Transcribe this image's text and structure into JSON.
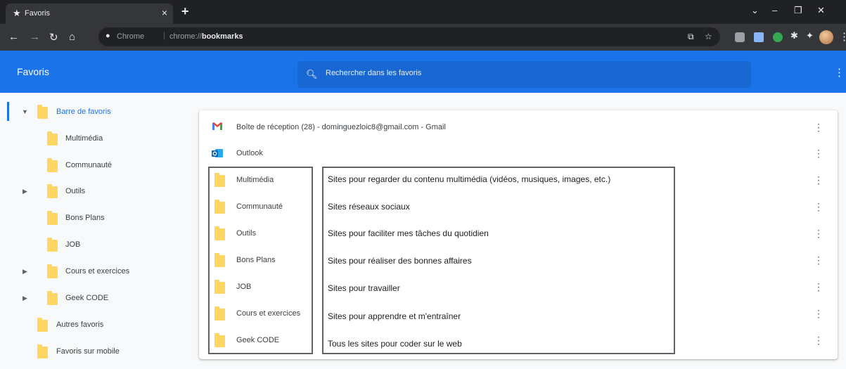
{
  "browser": {
    "tab_title": "Favoris",
    "address_label": "Chrome",
    "address_url_prefix": "chrome://",
    "address_url_bold": "bookmarks"
  },
  "app": {
    "title": "Favoris",
    "search_placeholder": "Rechercher dans les favoris"
  },
  "sidebar": {
    "items": [
      {
        "label": "Barre de favoris",
        "selected": true,
        "expanded": true,
        "has_children": true
      },
      {
        "label": "Multimédia",
        "has_children": false
      },
      {
        "label": "Communauté",
        "has_children": false
      },
      {
        "label": "Outils",
        "has_children": true
      },
      {
        "label": "Bons Plans",
        "has_children": false
      },
      {
        "label": "JOB",
        "has_children": false
      },
      {
        "label": "Cours et exercices",
        "has_children": true
      },
      {
        "label": "Geek CODE",
        "has_children": true
      },
      {
        "label": "Autres favoris",
        "has_children": false
      },
      {
        "label": "Favoris sur mobile",
        "has_children": false
      }
    ]
  },
  "list": {
    "rows": [
      {
        "label": "Boîte de réception (28) - dominguezloic8@gmail.com - Gmail",
        "icon": "gmail-icon"
      },
      {
        "label": "Outlook",
        "icon": "outlook-icon"
      },
      {
        "label": "Multimédia",
        "icon": "folder-icon"
      },
      {
        "label": "Communauté",
        "icon": "folder-icon"
      },
      {
        "label": "Outils",
        "icon": "folder-icon"
      },
      {
        "label": "Bons Plans",
        "icon": "folder-icon"
      },
      {
        "label": "JOB",
        "icon": "folder-icon"
      },
      {
        "label": "Cours et exercices",
        "icon": "folder-icon"
      },
      {
        "label": "Geek CODE",
        "icon": "folder-icon"
      }
    ]
  },
  "annotations": [
    "Sites pour regarder du contenu multimédia (vidéos, musiques, images, etc.)",
    "Sites réseaux sociaux",
    "Sites pour faciliter mes tâches du quotidien",
    "Sites pour réaliser des bonnes affaires",
    "Sites pour travailler",
    "Sites pour apprendre et m'entraîner",
    "Tous les sites pour coder sur le web"
  ],
  "colors": {
    "accent": "#1a73e8",
    "folder": "#fdd663",
    "chrome_dark": "#202124"
  }
}
